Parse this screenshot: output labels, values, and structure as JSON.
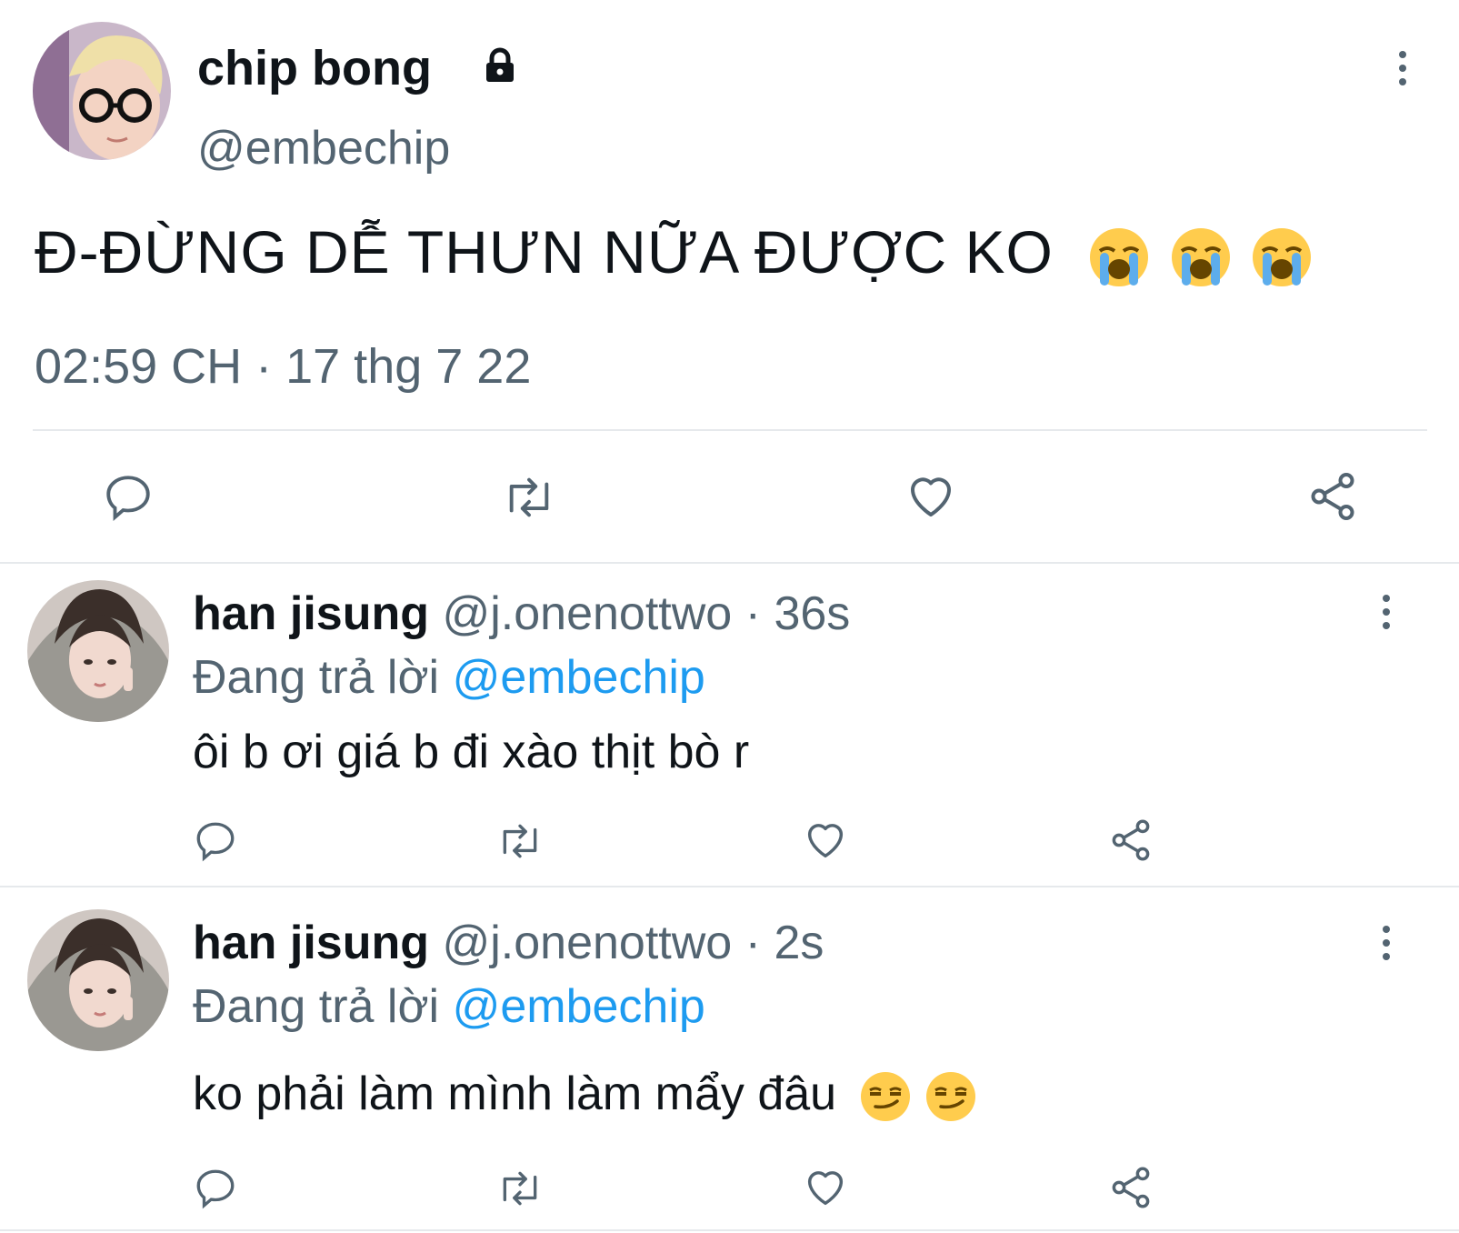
{
  "main_tweet": {
    "display_name": "chip bong",
    "handle": "@embechip",
    "text": "Đ-ĐỪNG DỄ THƯN NỮA ĐƯỢC KO",
    "emojis": [
      "loudly-crying-face",
      "loudly-crying-face",
      "loudly-crying-face"
    ],
    "timestamp": "02:59 CH · 17 thg 7 22",
    "protected": true
  },
  "replies": [
    {
      "display_name": "han jisung",
      "handle": "@j.onenottwo",
      "age": "36s",
      "separator": "·",
      "replying_prefix": "Đang trả lời",
      "replying_to": "@embechip",
      "text": "ôi b ơi giá b đi xào thịt bò r",
      "emojis": []
    },
    {
      "display_name": "han jisung",
      "handle": "@j.onenottwo",
      "age": "2s",
      "separator": "·",
      "replying_prefix": "Đang trả lời",
      "replying_to": "@embechip",
      "text": "ko phải làm mình làm mẩy đâu",
      "emojis": [
        "smirking-face",
        "smirking-face"
      ]
    }
  ],
  "actions": [
    "reply-icon",
    "retweet-icon",
    "like-icon",
    "share-icon"
  ],
  "colors": {
    "text": "#0f1419",
    "secondary": "#536471",
    "link": "#1d9bf0",
    "divider": "#e6e9ec"
  }
}
